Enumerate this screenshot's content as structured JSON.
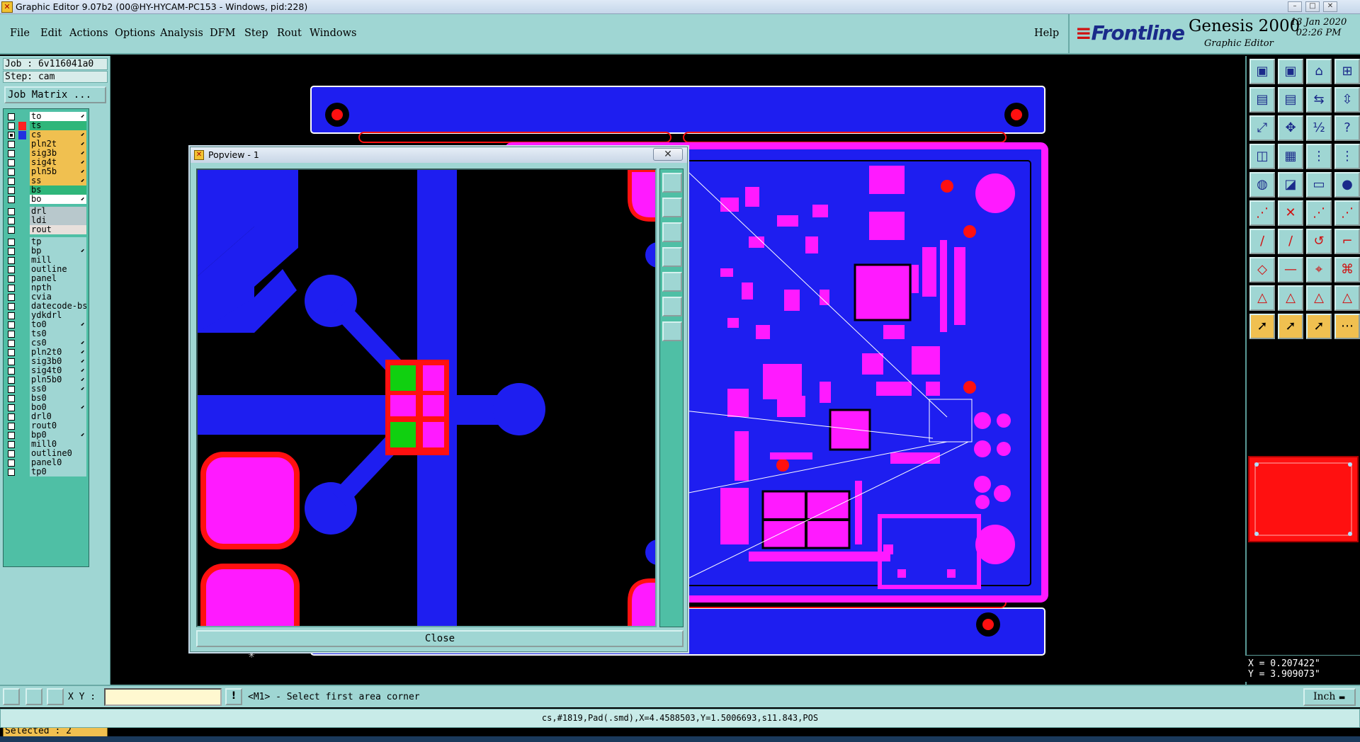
{
  "window": {
    "title": "Graphic Editor 9.07b2 (00@HY-HYCAM-PC153 - Windows, pid:228)",
    "minimize_glyph": "–",
    "maximize_glyph": "□",
    "close_glyph": "✕"
  },
  "menu": {
    "file": "File",
    "edit": "Edit",
    "actions": "Actions",
    "options": "Options",
    "analysis": "Analysis",
    "dfm": "DFM",
    "step": "Step",
    "rout": "Rout",
    "windows": "Windows",
    "help": "Help"
  },
  "brand": {
    "logo": "Frontline",
    "product": "Genesis 2000",
    "subtitle": "Graphic Editor",
    "date": "13 Jan 2020",
    "time": "02:26 PM"
  },
  "job": {
    "job_line": "Job : 6v116041a0",
    "step_line": "Step: cam",
    "job_matrix_button": "Job Matrix ..."
  },
  "layers": [
    {
      "name": "to",
      "bg": "#ffffff",
      "dot": "",
      "checked": false,
      "flag": "⬋"
    },
    {
      "name": "ts",
      "bg": "#2fb67a",
      "dot": "#ff2020",
      "checked": false,
      "flag": ""
    },
    {
      "name": "cs",
      "bg": "#f0c050",
      "dot": "#2030e0",
      "checked": true,
      "flag": "⬋"
    },
    {
      "name": "pln2t",
      "bg": "#f0c050",
      "dot": "",
      "checked": false,
      "flag": "⬋"
    },
    {
      "name": "sig3b",
      "bg": "#f0c050",
      "dot": "",
      "checked": false,
      "flag": "⬋"
    },
    {
      "name": "sig4t",
      "bg": "#f0c050",
      "dot": "",
      "checked": false,
      "flag": "⬋"
    },
    {
      "name": "pln5b",
      "bg": "#f0c050",
      "dot": "",
      "checked": false,
      "flag": "⬋"
    },
    {
      "name": "ss",
      "bg": "#f0c050",
      "dot": "",
      "checked": false,
      "flag": "⬋"
    },
    {
      "name": "bs",
      "bg": "#2fb67a",
      "dot": "",
      "checked": false,
      "flag": ""
    },
    {
      "name": "bo",
      "bg": "#ffffff",
      "dot": "",
      "checked": false,
      "flag": "⬋"
    },
    {
      "name": "drl",
      "bg": "#b8c8cc",
      "dot": "",
      "checked": false,
      "flag": ""
    },
    {
      "name": "ldi",
      "bg": "#b8c8cc",
      "dot": "",
      "checked": false,
      "flag": ""
    },
    {
      "name": "rout",
      "bg": "#e8e0dc",
      "dot": "",
      "checked": false,
      "flag": ""
    },
    {
      "name": "tp",
      "bg": "#9fd6d3",
      "dot": "",
      "checked": false,
      "flag": ""
    },
    {
      "name": "bp",
      "bg": "#9fd6d3",
      "dot": "",
      "checked": false,
      "flag": "⬋"
    },
    {
      "name": "mill",
      "bg": "#9fd6d3",
      "dot": "",
      "checked": false,
      "flag": ""
    },
    {
      "name": "outline",
      "bg": "#9fd6d3",
      "dot": "",
      "checked": false,
      "flag": ""
    },
    {
      "name": "panel",
      "bg": "#9fd6d3",
      "dot": "",
      "checked": false,
      "flag": ""
    },
    {
      "name": "npth",
      "bg": "#9fd6d3",
      "dot": "",
      "checked": false,
      "flag": ""
    },
    {
      "name": "cvia",
      "bg": "#9fd6d3",
      "dot": "",
      "checked": false,
      "flag": ""
    },
    {
      "name": "datecode-bs",
      "bg": "#9fd6d3",
      "dot": "",
      "checked": false,
      "flag": ""
    },
    {
      "name": "ydkdrl",
      "bg": "#9fd6d3",
      "dot": "",
      "checked": false,
      "flag": ""
    },
    {
      "name": "to0",
      "bg": "#9fd6d3",
      "dot": "",
      "checked": false,
      "flag": "⬋"
    },
    {
      "name": "ts0",
      "bg": "#9fd6d3",
      "dot": "",
      "checked": false,
      "flag": ""
    },
    {
      "name": "cs0",
      "bg": "#9fd6d3",
      "dot": "",
      "checked": false,
      "flag": "⬋"
    },
    {
      "name": "pln2t0",
      "bg": "#9fd6d3",
      "dot": "",
      "checked": false,
      "flag": "⬋"
    },
    {
      "name": "sig3b0",
      "bg": "#9fd6d3",
      "dot": "",
      "checked": false,
      "flag": "⬋"
    },
    {
      "name": "sig4t0",
      "bg": "#9fd6d3",
      "dot": "",
      "checked": false,
      "flag": "⬋"
    },
    {
      "name": "pln5b0",
      "bg": "#9fd6d3",
      "dot": "",
      "checked": false,
      "flag": "⬋"
    },
    {
      "name": "ss0",
      "bg": "#9fd6d3",
      "dot": "",
      "checked": false,
      "flag": "⬋"
    },
    {
      "name": "bs0",
      "bg": "#9fd6d3",
      "dot": "",
      "checked": false,
      "flag": ""
    },
    {
      "name": "bo0",
      "bg": "#9fd6d3",
      "dot": "",
      "checked": false,
      "flag": "⬋"
    },
    {
      "name": "drl0",
      "bg": "#9fd6d3",
      "dot": "",
      "checked": false,
      "flag": ""
    },
    {
      "name": "rout0",
      "bg": "#9fd6d3",
      "dot": "",
      "checked": false,
      "flag": ""
    },
    {
      "name": "bp0",
      "bg": "#9fd6d3",
      "dot": "",
      "checked": false,
      "flag": "⬋"
    },
    {
      "name": "mill0",
      "bg": "#9fd6d3",
      "dot": "",
      "checked": false,
      "flag": ""
    },
    {
      "name": "outline0",
      "bg": "#9fd6d3",
      "dot": "",
      "checked": false,
      "flag": ""
    },
    {
      "name": "panel0",
      "bg": "#9fd6d3",
      "dot": "",
      "checked": false,
      "flag": ""
    },
    {
      "name": "tp0",
      "bg": "#9fd6d3",
      "dot": "",
      "checked": false,
      "flag": ""
    }
  ],
  "selection": {
    "selected": "Selected : 2"
  },
  "popview": {
    "title": "Popview - 1",
    "close_button": "Close"
  },
  "coords": {
    "x": "X = 0.207422\"",
    "y": "Y = 3.909073\""
  },
  "command": {
    "xy_label": "X Y :",
    "xy_value": "",
    "prompt": "<M1> - Select first area corner",
    "units": "Inch"
  },
  "status": {
    "text": "cs,#1819,Pad(.smd),X=4.4588503,Y=1.5006693,s11.843,POS"
  },
  "colors": {
    "panel": "#9fd6d3",
    "board_blue": "#1e1ef0",
    "pad_magenta": "#ff1aff",
    "drill_red": "#ff1010",
    "highlight_green": "#10d010"
  }
}
